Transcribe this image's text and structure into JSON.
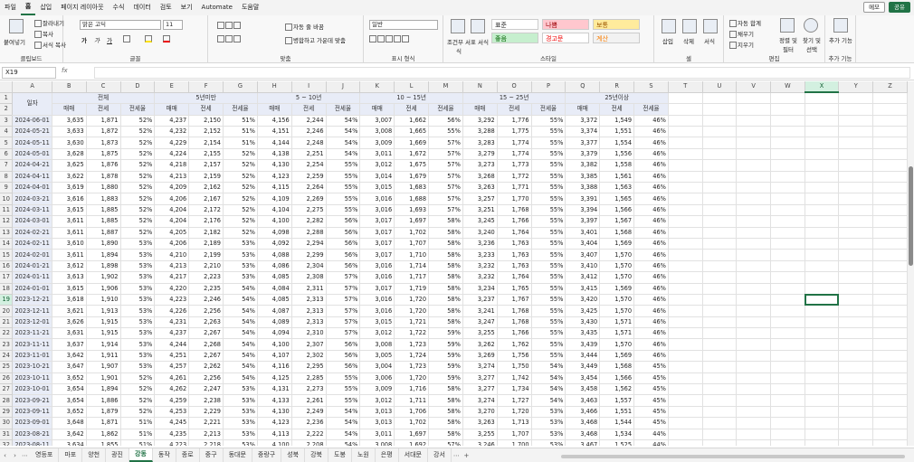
{
  "menu": {
    "items": [
      "파일",
      "홈",
      "삽입",
      "페이지 레이아웃",
      "수식",
      "데이터",
      "검토",
      "보기",
      "Automate",
      "도움말"
    ],
    "active": "홈",
    "comment_label": "메모",
    "share_label": "공유"
  },
  "ribbon": {
    "clipboard": {
      "label": "클립보드",
      "paste": "붙여넣기",
      "cut": "잘라내기",
      "copy": "복사",
      "format_painter": "서식 복사"
    },
    "font": {
      "label": "글꼴",
      "name": "맑은 고딕",
      "size": "11",
      "bold": "가",
      "italic": "가",
      "underline": "가"
    },
    "align": {
      "label": "맞춤",
      "wrap": "자동 줄 바꿈",
      "merge": "병합하고 가운데 맞춤"
    },
    "number": {
      "label": "표시 형식",
      "format": "일반"
    },
    "styles": {
      "label": "스타일",
      "cond_format": "조건부 서식",
      "table_format": "표 서식",
      "normal": "표준",
      "bad": "나쁨",
      "neutral": "보통",
      "good": "좋음",
      "warning": "경고문",
      "calc": "계산"
    },
    "cells": {
      "label": "셀",
      "insert": "삽입",
      "delete": "삭제",
      "format": "서식"
    },
    "edit": {
      "label": "편집",
      "autosum": "자동 합계",
      "fill": "채우기",
      "clear": "지우기",
      "sort": "정렬 및 필터",
      "find": "찾기 및 선택"
    },
    "addins": {
      "label": "추가 기능",
      "btn": "추가 기능"
    }
  },
  "formula_bar": {
    "name_box": "X19",
    "fx": "fx",
    "value": ""
  },
  "colors": {
    "accent": "#217346",
    "header_bg": "#e8ecf7",
    "good": "#c6efce",
    "bad": "#ffc7ce",
    "neutral": "#ffeb9c"
  },
  "grid": {
    "columns": [
      "A",
      "B",
      "C",
      "D",
      "E",
      "F",
      "G",
      "H",
      "I",
      "J",
      "K",
      "L",
      "M",
      "N",
      "O",
      "P",
      "Q",
      "R",
      "S",
      "T",
      "U",
      "V",
      "W",
      "X",
      "Y",
      "Z"
    ],
    "selected_column": "X",
    "selected_row": 19,
    "header_row1": {
      "date_label": "일자",
      "groups": [
        "전체",
        "5년미만",
        "5 ~ 10년",
        "10 ~ 15년",
        "15 ~ 25년",
        "25년이상"
      ]
    },
    "header_row2": [
      "매매",
      "전세",
      "전세율"
    ],
    "rows": [
      [
        "2024-06-01",
        "3,635",
        "1,871",
        "52%",
        "4,237",
        "2,150",
        "51%",
        "4,156",
        "2,244",
        "54%",
        "3,007",
        "1,662",
        "56%",
        "3,292",
        "1,776",
        "55%",
        "3,372",
        "1,549",
        "46%"
      ],
      [
        "2024-05-21",
        "3,633",
        "1,872",
        "52%",
        "4,232",
        "2,152",
        "51%",
        "4,151",
        "2,246",
        "54%",
        "3,008",
        "1,665",
        "55%",
        "3,288",
        "1,775",
        "55%",
        "3,374",
        "1,551",
        "46%"
      ],
      [
        "2024-05-11",
        "3,630",
        "1,873",
        "52%",
        "4,229",
        "2,154",
        "51%",
        "4,144",
        "2,248",
        "54%",
        "3,009",
        "1,669",
        "57%",
        "3,283",
        "1,774",
        "55%",
        "3,377",
        "1,554",
        "46%"
      ],
      [
        "2024-05-01",
        "3,628",
        "1,875",
        "52%",
        "4,224",
        "2,155",
        "52%",
        "4,138",
        "2,251",
        "54%",
        "3,011",
        "1,672",
        "57%",
        "3,279",
        "1,774",
        "55%",
        "3,379",
        "1,556",
        "46%"
      ],
      [
        "2024-04-21",
        "3,625",
        "1,876",
        "52%",
        "4,218",
        "2,157",
        "52%",
        "4,130",
        "2,254",
        "55%",
        "3,012",
        "1,675",
        "57%",
        "3,273",
        "1,773",
        "55%",
        "3,382",
        "1,558",
        "46%"
      ],
      [
        "2024-04-11",
        "3,622",
        "1,878",
        "52%",
        "4,213",
        "2,159",
        "52%",
        "4,123",
        "2,259",
        "55%",
        "3,014",
        "1,679",
        "57%",
        "3,268",
        "1,772",
        "55%",
        "3,385",
        "1,561",
        "46%"
      ],
      [
        "2024-04-01",
        "3,619",
        "1,880",
        "52%",
        "4,209",
        "2,162",
        "52%",
        "4,115",
        "2,264",
        "55%",
        "3,015",
        "1,683",
        "57%",
        "3,263",
        "1,771",
        "55%",
        "3,388",
        "1,563",
        "46%"
      ],
      [
        "2024-03-21",
        "3,616",
        "1,883",
        "52%",
        "4,206",
        "2,167",
        "52%",
        "4,109",
        "2,269",
        "55%",
        "3,016",
        "1,688",
        "57%",
        "3,257",
        "1,770",
        "55%",
        "3,391",
        "1,565",
        "46%"
      ],
      [
        "2024-03-11",
        "3,615",
        "1,885",
        "52%",
        "4,204",
        "2,172",
        "52%",
        "4,104",
        "2,275",
        "55%",
        "3,016",
        "1,693",
        "57%",
        "3,251",
        "1,768",
        "55%",
        "3,394",
        "1,566",
        "46%"
      ],
      [
        "2024-03-01",
        "3,611",
        "1,885",
        "52%",
        "4,204",
        "2,176",
        "52%",
        "4,100",
        "2,282",
        "56%",
        "3,017",
        "1,697",
        "58%",
        "3,245",
        "1,766",
        "55%",
        "3,397",
        "1,567",
        "46%"
      ],
      [
        "2024-02-21",
        "3,611",
        "1,887",
        "52%",
        "4,205",
        "2,182",
        "52%",
        "4,098",
        "2,288",
        "56%",
        "3,017",
        "1,702",
        "58%",
        "3,240",
        "1,764",
        "55%",
        "3,401",
        "1,568",
        "46%"
      ],
      [
        "2024-02-11",
        "3,610",
        "1,890",
        "53%",
        "4,206",
        "2,189",
        "53%",
        "4,092",
        "2,294",
        "56%",
        "3,017",
        "1,707",
        "58%",
        "3,236",
        "1,763",
        "55%",
        "3,404",
        "1,569",
        "46%"
      ],
      [
        "2024-02-01",
        "3,611",
        "1,894",
        "53%",
        "4,210",
        "2,199",
        "53%",
        "4,088",
        "2,299",
        "56%",
        "3,017",
        "1,710",
        "58%",
        "3,233",
        "1,763",
        "55%",
        "3,407",
        "1,570",
        "46%"
      ],
      [
        "2024-01-21",
        "3,612",
        "1,898",
        "53%",
        "4,213",
        "2,210",
        "53%",
        "4,086",
        "2,304",
        "56%",
        "3,016",
        "1,714",
        "58%",
        "3,232",
        "1,763",
        "55%",
        "3,410",
        "1,570",
        "46%"
      ],
      [
        "2024-01-11",
        "3,613",
        "1,902",
        "53%",
        "4,217",
        "2,223",
        "53%",
        "4,085",
        "2,308",
        "57%",
        "3,016",
        "1,717",
        "58%",
        "3,232",
        "1,764",
        "55%",
        "3,412",
        "1,570",
        "46%"
      ],
      [
        "2024-01-01",
        "3,615",
        "1,906",
        "53%",
        "4,220",
        "2,235",
        "54%",
        "4,084",
        "2,311",
        "57%",
        "3,017",
        "1,719",
        "58%",
        "3,234",
        "1,765",
        "55%",
        "3,415",
        "1,569",
        "46%"
      ],
      [
        "2023-12-21",
        "3,618",
        "1,910",
        "53%",
        "4,223",
        "2,246",
        "54%",
        "4,085",
        "2,313",
        "57%",
        "3,016",
        "1,720",
        "58%",
        "3,237",
        "1,767",
        "55%",
        "3,420",
        "1,570",
        "46%"
      ],
      [
        "2023-12-11",
        "3,621",
        "1,913",
        "53%",
        "4,226",
        "2,256",
        "54%",
        "4,087",
        "2,313",
        "57%",
        "3,016",
        "1,720",
        "58%",
        "3,241",
        "1,768",
        "55%",
        "3,425",
        "1,570",
        "46%"
      ],
      [
        "2023-12-01",
        "3,626",
        "1,915",
        "53%",
        "4,231",
        "2,263",
        "54%",
        "4,089",
        "2,313",
        "57%",
        "3,015",
        "1,721",
        "58%",
        "3,247",
        "1,768",
        "55%",
        "3,430",
        "1,571",
        "46%"
      ],
      [
        "2023-11-21",
        "3,631",
        "1,915",
        "53%",
        "4,237",
        "2,267",
        "54%",
        "4,094",
        "2,310",
        "57%",
        "3,012",
        "1,722",
        "59%",
        "3,255",
        "1,766",
        "55%",
        "3,435",
        "1,571",
        "46%"
      ],
      [
        "2023-11-11",
        "3,637",
        "1,914",
        "53%",
        "4,244",
        "2,268",
        "54%",
        "4,100",
        "2,307",
        "56%",
        "3,008",
        "1,723",
        "59%",
        "3,262",
        "1,762",
        "55%",
        "3,439",
        "1,570",
        "46%"
      ],
      [
        "2023-11-01",
        "3,642",
        "1,911",
        "53%",
        "4,251",
        "2,267",
        "54%",
        "4,107",
        "2,302",
        "56%",
        "3,005",
        "1,724",
        "59%",
        "3,269",
        "1,756",
        "55%",
        "3,444",
        "1,569",
        "46%"
      ],
      [
        "2023-10-21",
        "3,647",
        "1,907",
        "53%",
        "4,257",
        "2,262",
        "54%",
        "4,116",
        "2,295",
        "56%",
        "3,004",
        "1,723",
        "59%",
        "3,274",
        "1,750",
        "54%",
        "3,449",
        "1,568",
        "45%"
      ],
      [
        "2023-10-11",
        "3,652",
        "1,901",
        "52%",
        "4,261",
        "2,256",
        "54%",
        "4,125",
        "2,285",
        "55%",
        "3,006",
        "1,720",
        "59%",
        "3,277",
        "1,742",
        "54%",
        "3,454",
        "1,566",
        "45%"
      ],
      [
        "2023-10-01",
        "3,654",
        "1,894",
        "52%",
        "4,262",
        "2,247",
        "53%",
        "4,131",
        "2,273",
        "55%",
        "3,009",
        "1,716",
        "58%",
        "3,277",
        "1,734",
        "54%",
        "3,458",
        "1,562",
        "45%"
      ],
      [
        "2023-09-21",
        "3,654",
        "1,886",
        "52%",
        "4,259",
        "2,238",
        "53%",
        "4,133",
        "2,261",
        "55%",
        "3,012",
        "1,711",
        "58%",
        "3,274",
        "1,727",
        "54%",
        "3,463",
        "1,557",
        "45%"
      ],
      [
        "2023-09-11",
        "3,652",
        "1,879",
        "52%",
        "4,253",
        "2,229",
        "53%",
        "4,130",
        "2,249",
        "54%",
        "3,013",
        "1,706",
        "58%",
        "3,270",
        "1,720",
        "53%",
        "3,466",
        "1,551",
        "45%"
      ],
      [
        "2023-09-01",
        "3,648",
        "1,871",
        "51%",
        "4,245",
        "2,221",
        "53%",
        "4,123",
        "2,236",
        "54%",
        "3,013",
        "1,702",
        "58%",
        "3,263",
        "1,713",
        "53%",
        "3,468",
        "1,544",
        "45%"
      ],
      [
        "2023-08-21",
        "3,642",
        "1,862",
        "51%",
        "4,235",
        "2,213",
        "53%",
        "4,113",
        "2,222",
        "54%",
        "3,011",
        "1,697",
        "58%",
        "3,255",
        "1,707",
        "53%",
        "3,468",
        "1,534",
        "44%"
      ],
      [
        "2023-08-11",
        "3,634",
        "1,855",
        "51%",
        "4,223",
        "2,218",
        "53%",
        "4,100",
        "2,208",
        "54%",
        "3,008",
        "1,692",
        "57%",
        "3,246",
        "1,700",
        "53%",
        "3,467",
        "1,525",
        "44%"
      ]
    ]
  },
  "sheets": {
    "tabs": [
      "영등포",
      "마포",
      "양천",
      "광진",
      "강동",
      "동작",
      "종로",
      "중구",
      "동대문",
      "중랑구",
      "성북",
      "강북",
      "도봉",
      "노원",
      "은평",
      "서대문",
      "강서"
    ],
    "active": "강동",
    "add": "+",
    "more": "⋯"
  }
}
